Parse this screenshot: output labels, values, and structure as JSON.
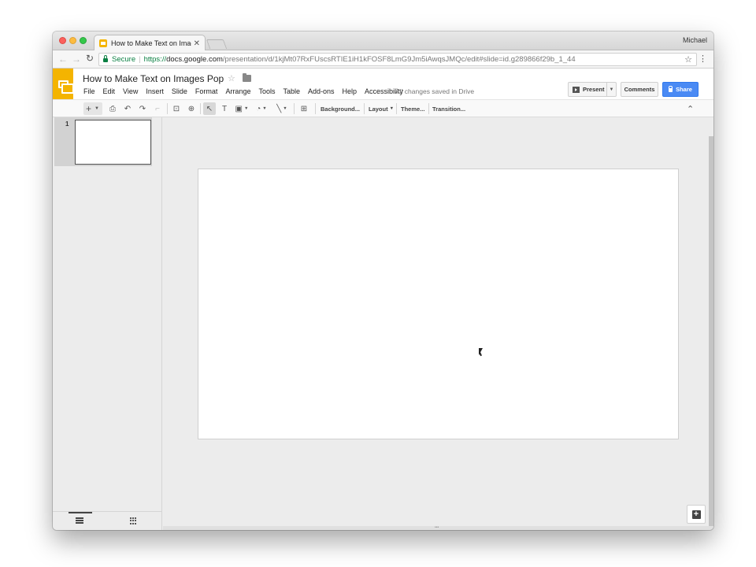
{
  "browser": {
    "tab_title": "How to Make Text on Images P",
    "tab_close": "✕",
    "profile": "Michael",
    "secure_label": "Secure",
    "url_scheme": "https://",
    "url_host": "docs.google.com",
    "url_path": "/presentation/d/1kjMt07RxFUscsRTIE1iH1kFOSF8LmG9Jm5iAwqsJMQc/edit#slide=id.g289866f29b_1_44",
    "icons": [
      "back-icon",
      "forward-icon",
      "reload-icon",
      "lock-icon",
      "bookmark-star-icon",
      "menu-kebab-icon"
    ]
  },
  "doc": {
    "title": "How to Make Text on Images Pop",
    "saved_status": "All changes saved in Drive",
    "menu": [
      "File",
      "Edit",
      "View",
      "Insert",
      "Slide",
      "Format",
      "Arrange",
      "Tools",
      "Table",
      "Add-ons",
      "Help",
      "Accessibility"
    ]
  },
  "buttons": {
    "present": "Present",
    "comments": "Comments",
    "share": "Share"
  },
  "toolbar": {
    "background": "Background...",
    "layout": "Layout",
    "theme": "Theme...",
    "transition": "Transition..."
  },
  "filmstrip": {
    "slides": [
      {
        "number": "1"
      }
    ]
  },
  "colors": {
    "slides_brand": "#f4b400",
    "share_blue": "#4a8af4",
    "secure_green": "#0b8043"
  }
}
